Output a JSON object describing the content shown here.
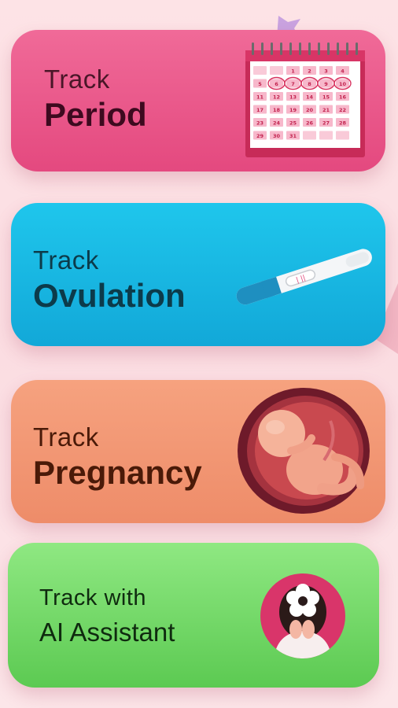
{
  "cards": [
    {
      "id": "period",
      "line1": "Track",
      "line2": "Period"
    },
    {
      "id": "ovulation",
      "line1": "Track",
      "line2": "Ovulation"
    },
    {
      "id": "pregnancy",
      "line1": "Track",
      "line2": "Pregnancy"
    },
    {
      "id": "ai",
      "line1": "Track with",
      "line2": "AI Assistant"
    }
  ],
  "calendar": {
    "rows": [
      [
        "",
        "",
        "1",
        "2",
        "3",
        "4"
      ],
      [
        "5",
        "6",
        "7",
        "8",
        "9",
        "10"
      ],
      [
        "11",
        "12",
        "13",
        "14",
        "15",
        "16"
      ],
      [
        "17",
        "18",
        "19",
        "20",
        "21",
        "22"
      ],
      [
        "23",
        "24",
        "25",
        "26",
        "27",
        "28"
      ],
      [
        "29",
        "30",
        "31",
        "",
        "",
        ""
      ]
    ],
    "highlighted_days": [
      "6",
      "7",
      "8",
      "9",
      "10"
    ]
  },
  "test_strip_text": "| ||",
  "colors": {
    "period": "#e4497f",
    "ovulation": "#12a8d8",
    "pregnancy": "#ee8c69",
    "ai": "#5cca52"
  },
  "icons": {
    "period": "calendar-icon",
    "ovulation": "ovulation-test-icon",
    "pregnancy": "fetus-in-womb-icon",
    "ai": "assistant-avatar-icon"
  }
}
